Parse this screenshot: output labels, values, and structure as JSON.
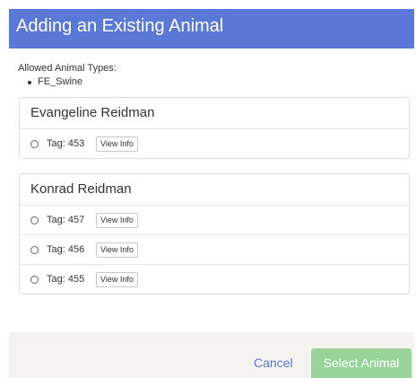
{
  "modal": {
    "title": "Adding an Existing Animal"
  },
  "allowed": {
    "label": "Allowed Animal Types:",
    "types": [
      "FE_Swine"
    ]
  },
  "owners": [
    {
      "name": "Evangeline Reidman",
      "animals": [
        {
          "tag": "Tag: 453",
          "view_label": "View Info",
          "selected": false
        }
      ]
    },
    {
      "name": "Konrad Reidman",
      "animals": [
        {
          "tag": "Tag: 457",
          "view_label": "View Info",
          "selected": false
        },
        {
          "tag": "Tag: 456",
          "view_label": "View Info",
          "selected": false
        },
        {
          "tag": "Tag: 455",
          "view_label": "View Info",
          "selected": false
        }
      ]
    }
  ],
  "footer": {
    "cancel_label": "Cancel",
    "select_label": "Select Animal"
  },
  "colors": {
    "header_bg": "#5a79d6",
    "select_button_bg": "#98d39a",
    "footer_bg": "#f5f3f0",
    "cancel_text": "#5a79d6"
  }
}
